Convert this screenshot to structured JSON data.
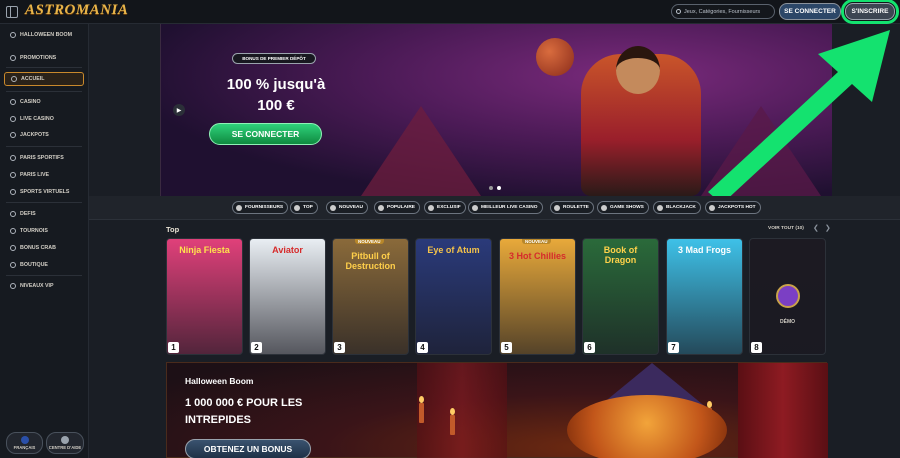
{
  "brand": {
    "logo_text": "ASTROMANIA"
  },
  "header": {
    "search_placeholder": "Jeux, Catégories, Fournisseurs",
    "login_label": "SE CONNECTER",
    "signup_label": "S'INSCRIRE"
  },
  "sidebar": {
    "items": [
      {
        "label": "HALLOWEEN BOOM",
        "icon": "ghost-icon"
      },
      {
        "label": "PROMOTIONS",
        "icon": "gift-icon"
      },
      {
        "label": "ACCUEIL",
        "icon": "home-icon",
        "active": true
      },
      {
        "label": "CASINO",
        "icon": "cherry-icon"
      },
      {
        "label": "LIVE CASINO",
        "icon": "live-icon"
      },
      {
        "label": "JACKPOTS",
        "icon": "coins-icon"
      },
      {
        "label": "PARIS SPORTIFS",
        "icon": "ball-icon"
      },
      {
        "label": "PARIS LIVE",
        "icon": "live-bet-icon"
      },
      {
        "label": "SPORTS VIRTUELS",
        "icon": "virtual-icon"
      },
      {
        "label": "DEFIS",
        "icon": "target-icon"
      },
      {
        "label": "TOURNOIS",
        "icon": "trophy-icon"
      },
      {
        "label": "BONUS CRAB",
        "icon": "crab-icon"
      },
      {
        "label": "BOUTIQUE",
        "icon": "shop-icon"
      },
      {
        "label": "NIVEAUX VIP",
        "icon": "vip-icon"
      }
    ],
    "language_label": "FRANÇAIS",
    "help_label": "CENTRE D'AIDE"
  },
  "hero": {
    "badge": "BONUS DE PREMIER DÉPÔT",
    "title_line1": "100 % jusqu'à",
    "title_line2": "100 €",
    "cta": "SE CONNECTER",
    "slide_count": 2,
    "active_slide": 2
  },
  "categories": [
    {
      "label": "FOURNISSEURS",
      "icon": "provider-icon"
    },
    {
      "label": "TOP",
      "icon": "trophy-icon"
    },
    {
      "label": "NOUVEAU",
      "icon": "bolt-icon"
    },
    {
      "label": "POPULAIRE",
      "icon": "fire-icon"
    },
    {
      "label": "EXCLUSIF",
      "icon": "crown-icon"
    },
    {
      "label": "MEILLEUR LIVE CASINO",
      "icon": "live-icon"
    },
    {
      "label": "ROULETTE",
      "icon": "roulette-icon"
    },
    {
      "label": "GAME SHOWS",
      "icon": "mic-icon"
    },
    {
      "label": "BLACKJACK",
      "icon": "cards-icon"
    },
    {
      "label": "JACKPOTS HOT",
      "icon": "coins-icon"
    }
  ],
  "top_section": {
    "title": "Top",
    "see_all": "VOIR TOUT (10)",
    "games": [
      {
        "rank": "1",
        "title": "Ninja Fiesta",
        "bg": "#e0407a",
        "fg": "#ffe34d"
      },
      {
        "rank": "2",
        "title": "Aviator",
        "bg": "#e9eef3",
        "fg": "#d62b2b"
      },
      {
        "rank": "3",
        "title": "Pitbull of Destruction",
        "bg": "#8a6a3a",
        "fg": "#ffcf4a",
        "badge": "NOUVEAU"
      },
      {
        "rank": "4",
        "title": "Eye of Atum",
        "bg": "#2a3a7a",
        "fg": "#f4c24a"
      },
      {
        "rank": "5",
        "title": "3 Hot Chillies",
        "bg": "#e8a93a",
        "fg": "#d62b2b",
        "badge": "NOUVEAU"
      },
      {
        "rank": "6",
        "title": "Book of Dragon",
        "bg": "#2a6a3a",
        "fg": "#ffd24a"
      },
      {
        "rank": "7",
        "title": "3 Mad Frogs",
        "bg": "#3ec1e8",
        "fg": "#ffffff"
      },
      {
        "rank": "8",
        "title": "DÉMO",
        "bg": "#1c1a22",
        "fg": "#d3cfc6"
      }
    ]
  },
  "promo": {
    "kicker": "Halloween Boom",
    "title": "1 000 000 € POUR LES INTREPIDES",
    "cta": "OBTENEZ UN BONUS"
  },
  "colors": {
    "accent_green": "#14e26f",
    "primary_green": "#1fb85c",
    "gold": "#c9892c"
  }
}
